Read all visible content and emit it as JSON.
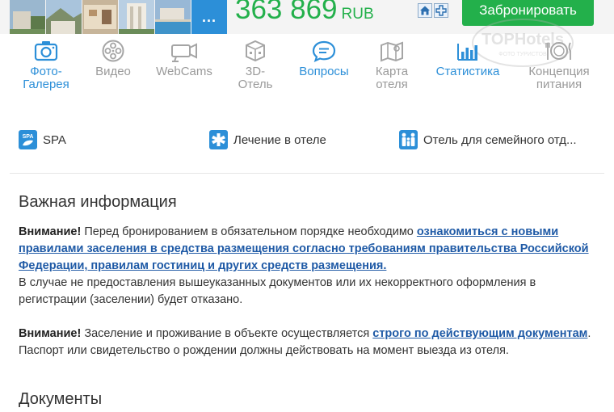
{
  "header": {
    "more_label": "...",
    "price_value": "363 869",
    "price_currency": "RUB",
    "book_button": "Забронировать",
    "watermark_text": "TOPHotels",
    "watermark_sub": "ФОТО ТУРИСТОВ"
  },
  "features": [
    {
      "icon": "photo-camera-icon",
      "label_line1": "Фото-",
      "label_line2": "Галерея",
      "active": true
    },
    {
      "icon": "film-reel-icon",
      "label_line1": "Видео",
      "label_line2": "",
      "active": false
    },
    {
      "icon": "webcam-icon",
      "label_line1": "WebCams",
      "label_line2": "",
      "active": false
    },
    {
      "icon": "3d-box-icon",
      "label_line1": "3D-",
      "label_line2": "Отель",
      "active": false
    },
    {
      "icon": "chat-bubble-icon",
      "label_line1": "Вопросы",
      "label_line2": "",
      "active": true
    },
    {
      "icon": "map-icon",
      "label_line1": "Карта",
      "label_line2": "отеля",
      "active": false
    },
    {
      "icon": "bar-chart-icon",
      "label_line1": "Статистика",
      "label_line2": "",
      "active": true
    },
    {
      "icon": "dining-plate-icon",
      "label_line1": "Концепция",
      "label_line2": "питания",
      "active": false
    }
  ],
  "amenities": [
    {
      "icon": "spa-icon",
      "icon_text": "SPA",
      "label": "SPA"
    },
    {
      "icon": "medical-icon",
      "label": "Лечение в отеле"
    },
    {
      "icon": "family-icon",
      "label": "Отель для семейного отд..."
    }
  ],
  "important": {
    "title": "Важная информация",
    "p1_strong": "Внимание!",
    "p1_text": " Перед бронированием в обязательном порядке необходимо ",
    "p1_link": "ознакомиться с новыми правилами заселения в средства размещения согласно требованиям правительства Российской Федерации, правилам гостиниц и других средств размещения.",
    "p1_tail": "В случае не предоставления вышеуказанных документов или их некорректного оформления в регистрации (заселении) будет отказано.",
    "p2_strong": "Внимание!",
    "p2_text": " Заселение и проживание в объекте осуществляется ",
    "p2_link": "строго по действующим документам",
    "p2_tail": ". Паспорт или свидетельство о рождении должны действовать на момент выезда из отеля."
  },
  "documents": {
    "title": "Документы"
  },
  "colors": {
    "accent_green": "#23b04b",
    "accent_blue": "#2c8fd8",
    "link_blue": "#1f5aa6",
    "inactive_gray": "#9a9a9a"
  }
}
